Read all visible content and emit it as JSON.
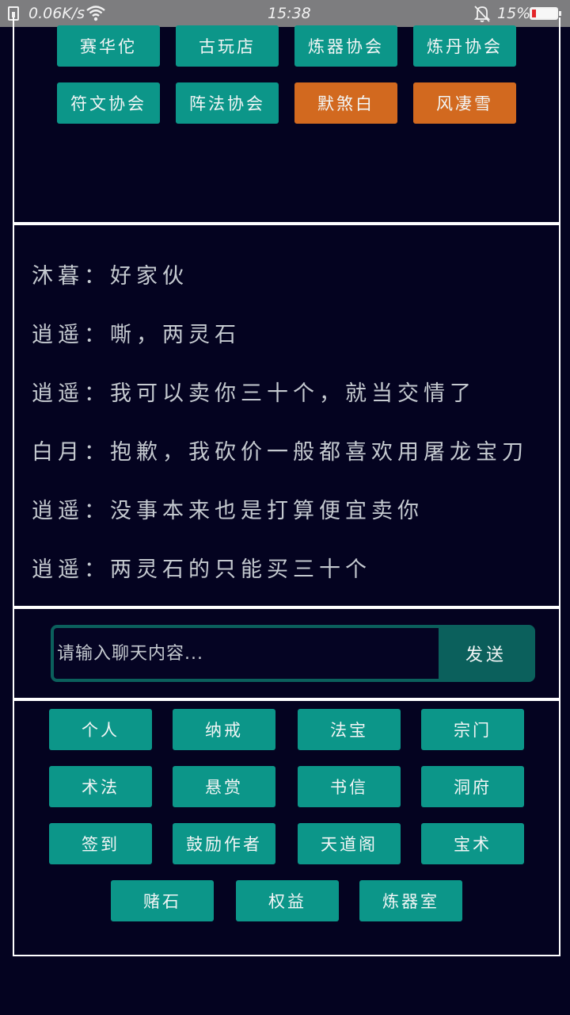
{
  "status_bar": {
    "speed": "0.06K/s",
    "time": "15:38",
    "battery_percent": "15%",
    "battery_level": 0.15,
    "icons": [
      "sim-icon",
      "wifi-icon",
      "bell-muted-icon",
      "battery-icon"
    ]
  },
  "top_buttons": [
    {
      "label": "赛华佗",
      "color": "#0c9689"
    },
    {
      "label": "古玩店",
      "color": "#0c9689"
    },
    {
      "label": "炼器协会",
      "color": "#0c9689"
    },
    {
      "label": "炼丹协会",
      "color": "#0c9689"
    },
    {
      "label": "符文协会",
      "color": "#0c9689"
    },
    {
      "label": "阵法协会",
      "color": "#0c9689"
    },
    {
      "label": "默煞白",
      "color": "#d2691f"
    },
    {
      "label": "风凄雪",
      "color": "#d2691f"
    }
  ],
  "chat": {
    "messages": [
      "沐暮：好家伙",
      "逍遥：嘶，两灵石",
      "逍遥：我可以卖你三十个，就当交情了",
      "白月：抱歉，我砍价一般都喜欢用屠龙宝刀",
      "逍遥：没事本来也是打算便宜卖你",
      "逍遥：两灵石的只能买三十个"
    ]
  },
  "input": {
    "placeholder": "请输入聊天内容...",
    "value": "",
    "send_label": "发送"
  },
  "menu": {
    "items": [
      "个人",
      "纳戒",
      "法宝",
      "宗门",
      "术法",
      "悬赏",
      "书信",
      "洞府",
      "签到",
      "鼓励作者",
      "天道阁",
      "宝术",
      "赌石",
      "权益",
      "炼器室"
    ]
  },
  "colors": {
    "background": "#040320",
    "button_teal": "#0c9689",
    "button_orange": "#d2691f",
    "input_frame": "#0b605c",
    "status_bar": "#7d7d7f"
  }
}
